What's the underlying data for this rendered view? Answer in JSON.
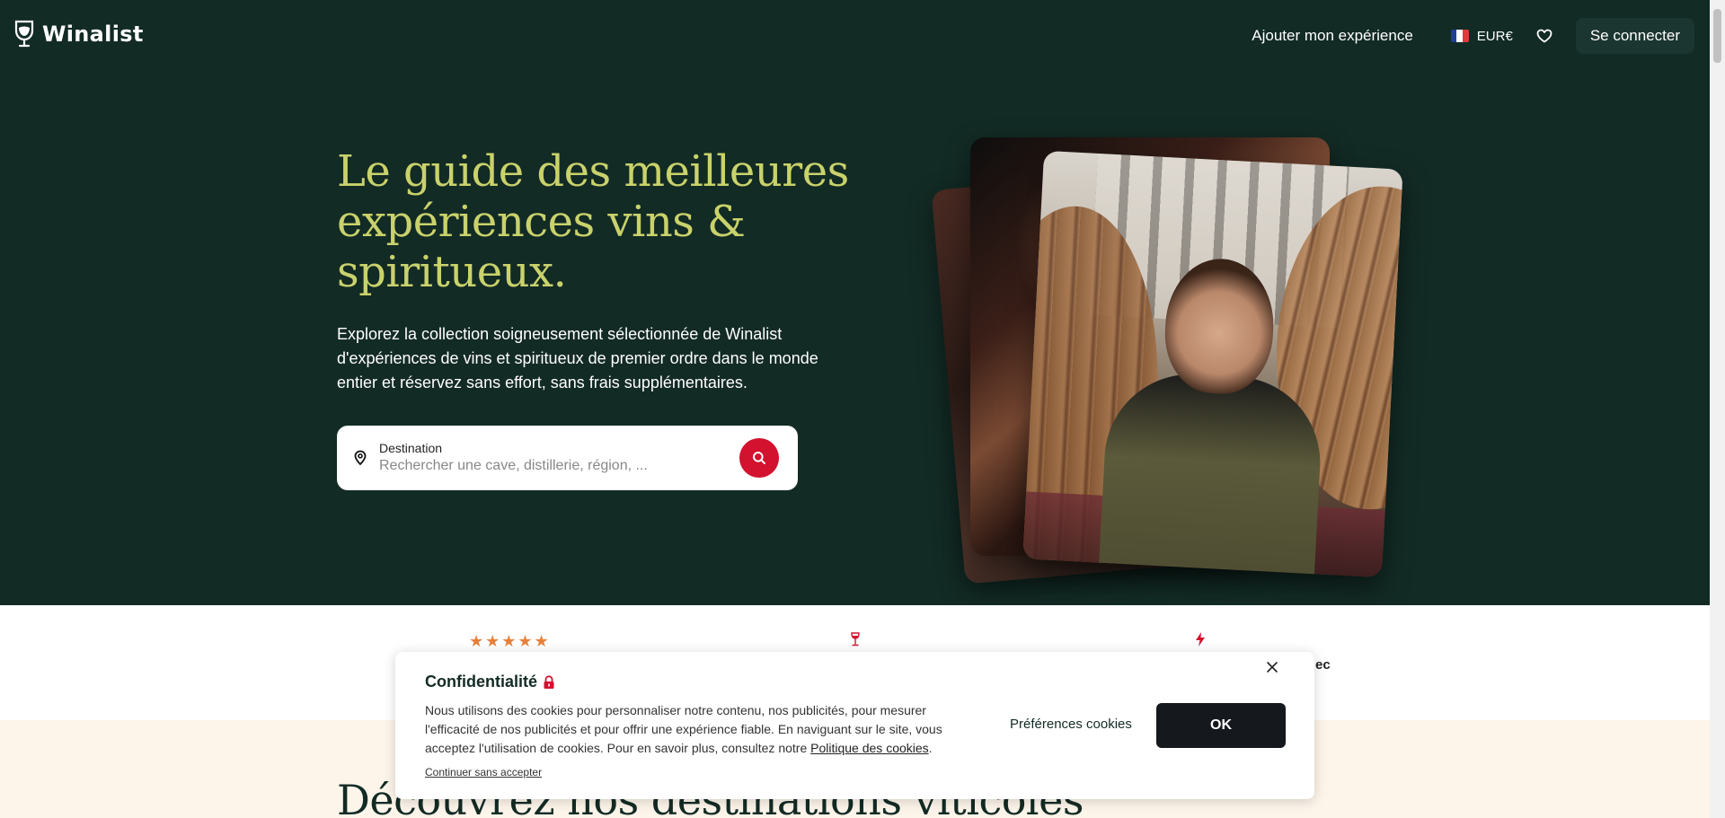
{
  "header": {
    "logo_text": "Winalist",
    "add_experience_label": "Ajouter mon expérience",
    "currency_label": "EUR€",
    "login_label": "Se connecter"
  },
  "hero": {
    "title": "Le guide des meilleures expériences vins & spiritueux.",
    "subtitle": "Explorez la collection soigneusement sélectionnée de Winalist d'expériences de vins et spiritueux de premier ordre dans le monde entier et réservez sans effort, sans frais supplémentaires.",
    "search": {
      "label": "Destination",
      "placeholder": "Rechercher une cave, distillerie, région, ..."
    }
  },
  "features": {
    "stars": "★★★★★",
    "rating_fragment": "",
    "right_fragment": "ec"
  },
  "section": {
    "title": "Découvrez nos destinations viticoles"
  },
  "cookie": {
    "title": "Confidentialité",
    "text_before_link": "Nous utilisons des cookies pour personnaliser notre contenu, nos publicités, pour mesurer l'efficacité de nos publicités et pour offrir une expérience fiable. En naviguant sur le site, vous acceptez l'utilisation de cookies. Pour en savoir plus, consultez notre ",
    "link_label": "Politique des cookies",
    "text_after_link": ".",
    "continue_label": "Continuer sans accepter",
    "preferences_label": "Préférences cookies",
    "ok_label": "OK"
  },
  "colors": {
    "header_bg": "#132b25",
    "title_accent": "#c9d26b",
    "search_button": "#d2122e",
    "cream": "#fdf5ea",
    "star": "#e8803a"
  },
  "icons": [
    "winalist-logo-icon",
    "france-flag-icon",
    "heart-icon",
    "location-pin-icon",
    "search-icon",
    "star-icon",
    "wine-glass-icon",
    "bolt-icon",
    "lock-icon",
    "close-icon"
  ]
}
